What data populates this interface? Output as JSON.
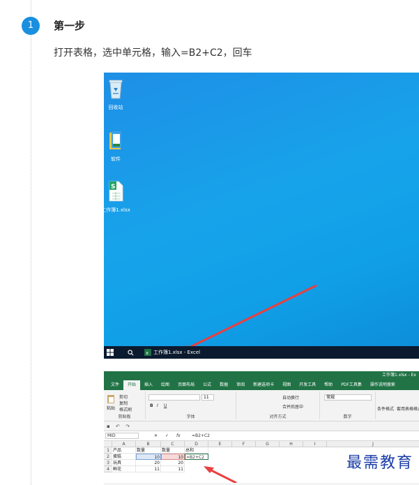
{
  "step": {
    "number": "1",
    "title": "第一步",
    "instruction": "打开表格，选中单元格，输入=B2+C2，回车"
  },
  "desktop": {
    "icons": [
      {
        "name": "recycle-bin",
        "label": "回收站"
      },
      {
        "name": "software-folder",
        "label": "软件"
      },
      {
        "name": "xlsx-file",
        "label": "工作簿1.xlsx"
      }
    ],
    "taskbar": {
      "app_label": "工作簿1.xlsx - Excel"
    }
  },
  "excel": {
    "title_right": "工作簿1.xlsx - Ex",
    "menu": [
      "文件",
      "开始",
      "插入",
      "绘图",
      "页面布局",
      "公式",
      "数据",
      "审阅",
      "新建选项卡",
      "视图",
      "开发工具",
      "帮助",
      "PDF工具集",
      "操作说明搜索"
    ],
    "active_menu": "开始",
    "ribbon": {
      "clipboard": {
        "paste": "粘贴",
        "cut": "剪切",
        "copy": "复制",
        "format_painter": "格式刷",
        "group": "剪贴板"
      },
      "font": {
        "size": "11",
        "bold": "B",
        "italic": "I",
        "underline": "U",
        "group": "字体"
      },
      "align": {
        "wrap": "自动换行",
        "merge": "合并后居中",
        "group": "对齐方式"
      },
      "number": {
        "format": "常规",
        "group": "数字"
      },
      "styles": {
        "conditional": "条件格式",
        "table_format": "套用表格格式"
      }
    },
    "name_box": "MID",
    "formula": "=B2+C2",
    "fx": "fx",
    "columns": [
      "A",
      "B",
      "C",
      "D",
      "E",
      "F",
      "G",
      "H",
      "I",
      "J"
    ],
    "rows": [
      [
        "1",
        "产品",
        "数量",
        "数量",
        "总和"
      ],
      [
        "2",
        "蛋糕",
        "10",
        "10",
        "=B2+C2"
      ],
      [
        "3",
        "玩具",
        "20",
        "20",
        ""
      ],
      [
        "4",
        "鲜花",
        "11",
        "11",
        ""
      ]
    ]
  },
  "watermark": "最需教育"
}
